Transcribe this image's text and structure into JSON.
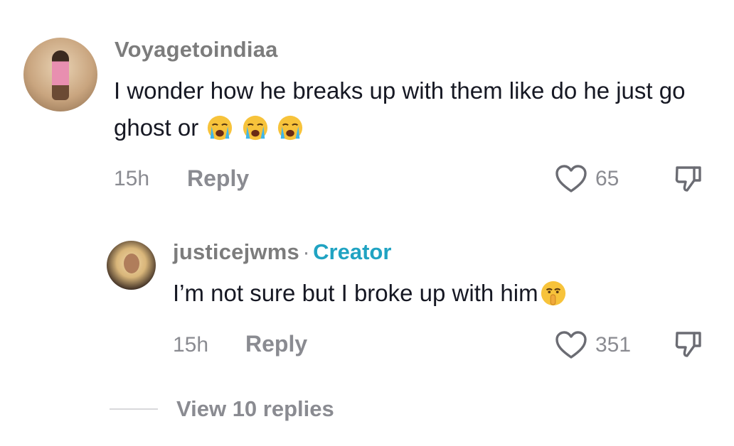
{
  "comment": {
    "username": "Voyagetoindiaa",
    "text": "I wonder how he breaks up with them like do he just go ghost or",
    "emojis": [
      "loudly-crying-face",
      "loudly-crying-face",
      "loudly-crying-face"
    ],
    "time": "15h",
    "reply_label": "Reply",
    "likes": "65"
  },
  "reply": {
    "username": "justicejwms",
    "separator": "·",
    "badge": "Creator",
    "text": "I’m not sure but I broke up with him",
    "emoji": "shushing-face",
    "time": "15h",
    "reply_label": "Reply",
    "likes": "351"
  },
  "view_replies": "View 10 replies",
  "colors": {
    "text": "#161823",
    "muted": "#8a8b91",
    "creator_badge": "#20a3c2"
  }
}
